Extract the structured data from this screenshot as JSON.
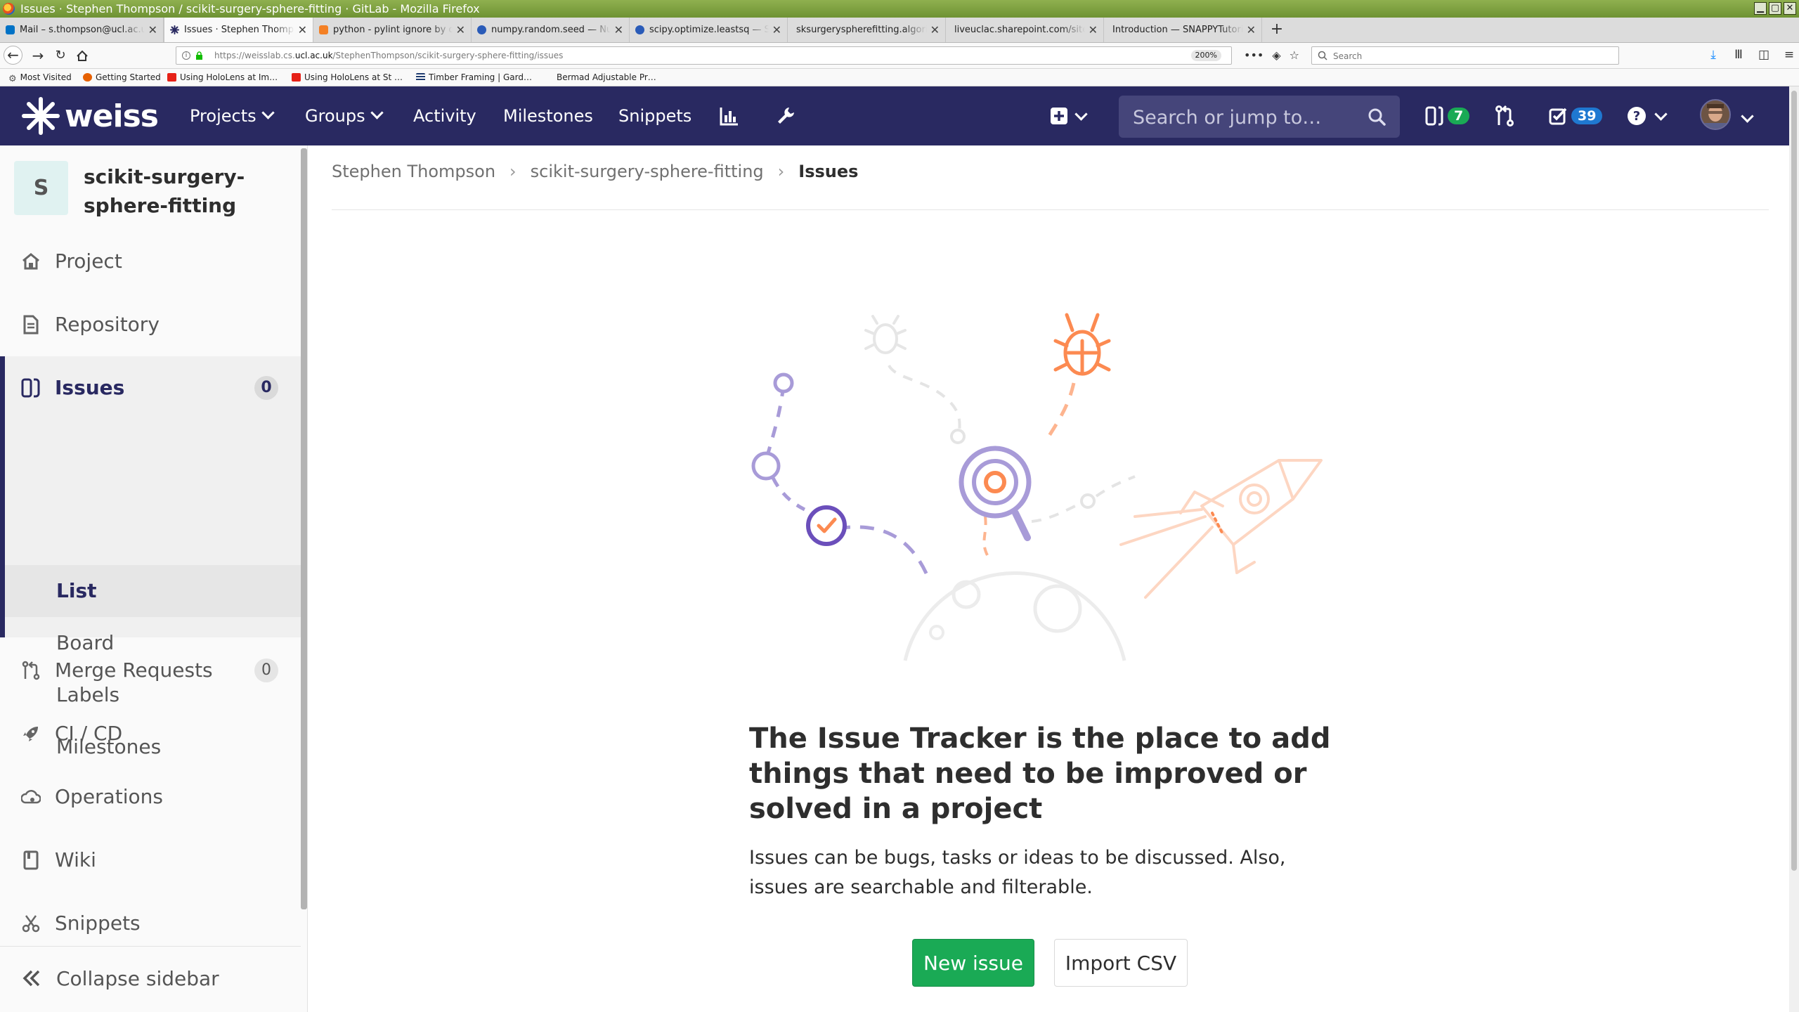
{
  "window": {
    "title": "Issues · Stephen Thompson / scikit-surgery-sphere-fitting · GitLab - Mozilla Firefox"
  },
  "tabs": [
    {
      "label": "Mail – s.thompson@ucl.ac.uk",
      "icon": "outlook-icon",
      "color": "#0072c6"
    },
    {
      "label": "Issues · Stephen Thompson",
      "icon": "weiss-icon",
      "color": "#292961"
    },
    {
      "label": "python - pylint ignore by directory",
      "icon": "stackoverflow-icon",
      "color": "#f48024"
    },
    {
      "label": "numpy.random.seed — NumPy",
      "icon": "scipy-icon",
      "color": "#2a5bb8"
    },
    {
      "label": "scipy.optimize.leastsq — SciPy",
      "icon": "scipy-icon",
      "color": "#2a5bb8"
    },
    {
      "label": "sksurgeryspherefitting.algorithms",
      "icon": "blank-icon",
      "color": "#ffffff"
    },
    {
      "label": "liveuclac.sharepoint.com/sites/",
      "icon": "blank-icon",
      "color": "#ffffff"
    },
    {
      "label": "Introduction — SNAPPYTutorial",
      "icon": "blank-icon",
      "color": "#ffffff"
    }
  ],
  "nav": {
    "url_prefix": "https://weisslab.cs.",
    "url_domain": "ucl.ac.uk",
    "url_path": "/StephenThompson/scikit-surgery-sphere-fitting/issues",
    "zoom": "200%",
    "search_placeholder": "Search"
  },
  "bookmarks": [
    {
      "label": "Most Visited",
      "icon": "gear-icon",
      "color": "#555555"
    },
    {
      "label": "Getting Started",
      "icon": "firefox-icon",
      "color": "#e66000"
    },
    {
      "label": "Using HoloLens at Im…",
      "icon": "youtube-icon",
      "color": "#e62117"
    },
    {
      "label": "Using HoloLens at St …",
      "icon": "youtube-icon",
      "color": "#e62117"
    },
    {
      "label": "Timber Framing | Gard…",
      "icon": "site-icon",
      "color": "#1d3a6e"
    },
    {
      "label": "Bermad Adjustable Pr…",
      "icon": "blank-icon",
      "color": "#ffffff"
    }
  ],
  "gitlab": {
    "brand": "weiss",
    "nav": [
      "Projects",
      "Groups",
      "Activity",
      "Milestones",
      "Snippets"
    ],
    "search_placeholder": "Search or jump to…",
    "issues_count": "7",
    "todos_count": "39",
    "colors": {
      "header": "#292961",
      "issues_badge": "#1aaa55",
      "todos_badge": "#1f78d1"
    }
  },
  "sidebar": {
    "project_initial": "S",
    "project_name": "scikit-surgery-sphere-fitting",
    "items": {
      "project": "Project",
      "repository": "Repository",
      "issues": "Issues",
      "issues_count": "0",
      "merge_requests": "Merge Requests",
      "merge_requests_count": "0",
      "cicd": "CI / CD",
      "operations": "Operations",
      "wiki": "Wiki",
      "snippets": "Snippets"
    },
    "issues_sub": [
      "List",
      "Board",
      "Labels",
      "Milestones"
    ],
    "collapse": "Collapse sidebar"
  },
  "breadcrumbs": [
    "Stephen Thompson",
    "scikit-surgery-sphere-fitting",
    "Issues"
  ],
  "empty_state": {
    "title": "The Issue Tracker is the place to add things that need to be improved or solved in a project",
    "description": "Issues can be bugs, tasks or ideas to be discussed. Also, issues are searchable and filterable.",
    "new_issue": "New issue",
    "import_csv": "Import CSV",
    "colors": {
      "primary": "#1aaa55",
      "purple": "#6b4fbb",
      "orange": "#fc8a51"
    }
  }
}
